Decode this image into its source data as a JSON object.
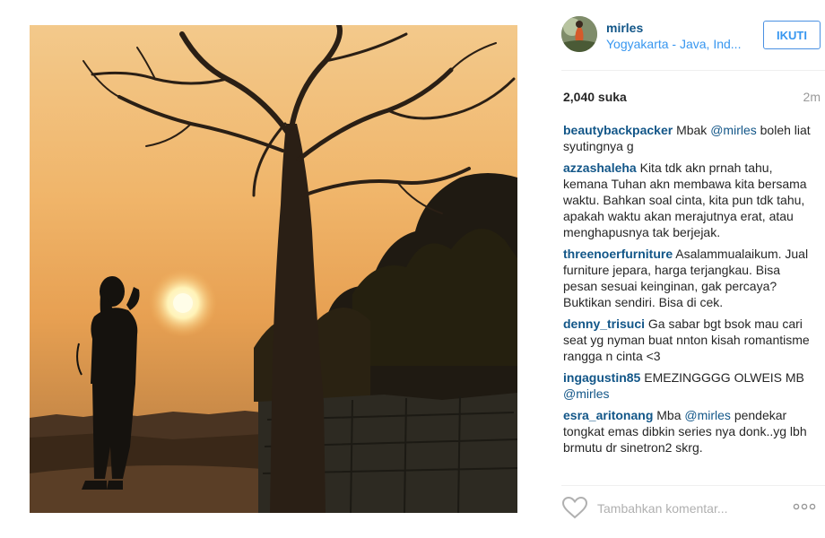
{
  "post": {
    "username": "mirles",
    "location": "Yogyakarta - Java, Ind...",
    "follow_label": "IKUTI",
    "likes": "2,040 suka",
    "time": "2m"
  },
  "comments": [
    {
      "user": "beautybackpacker",
      "parts": [
        {
          "t": " Mbak "
        },
        {
          "t": "@mirles",
          "m": true
        },
        {
          "t": " boleh liat syutingnya g"
        }
      ]
    },
    {
      "user": "azzashaleha",
      "parts": [
        {
          "t": " Kita tdk akn prnah tahu, kemana Tuhan akn membawa kita bersama waktu. Bahkan soal cinta, kita pun tdk tahu, apakah waktu akan merajutnya erat, atau menghapusnya tak berjejak."
        }
      ]
    },
    {
      "user": "threenoerfurniture",
      "parts": [
        {
          "t": " Asalammualaikum. Jual furniture jepara, harga terjangkau. Bisa pesan sesuai keinginan, gak percaya? Buktikan sendiri. Bisa di cek."
        }
      ]
    },
    {
      "user": "denny_trisuci",
      "parts": [
        {
          "t": " Ga sabar bgt bsok mau cari seat yg nyman buat nnton kisah romantisme rangga n cinta <3"
        }
      ]
    },
    {
      "user": "ingagustin85",
      "parts": [
        {
          "t": " EMEZINGGGG OLWEIS MB "
        },
        {
          "t": "@mirles",
          "m": true
        }
      ]
    },
    {
      "user": "esra_aritonang",
      "parts": [
        {
          "t": " Mba "
        },
        {
          "t": "@mirles",
          "m": true
        },
        {
          "t": " pendekar tongkat emas dibkin series nya donk..yg lbh brmutu dr sinetron2 skrg."
        }
      ]
    }
  ],
  "footer": {
    "comment_placeholder": "Tambahkan komentar...",
    "like_icon": "heart-outline-icon",
    "more_icon": "ellipsis-icon"
  },
  "colors": {
    "username": "#125688",
    "location": "#3897f0",
    "follow_border": "#4a90e2"
  }
}
